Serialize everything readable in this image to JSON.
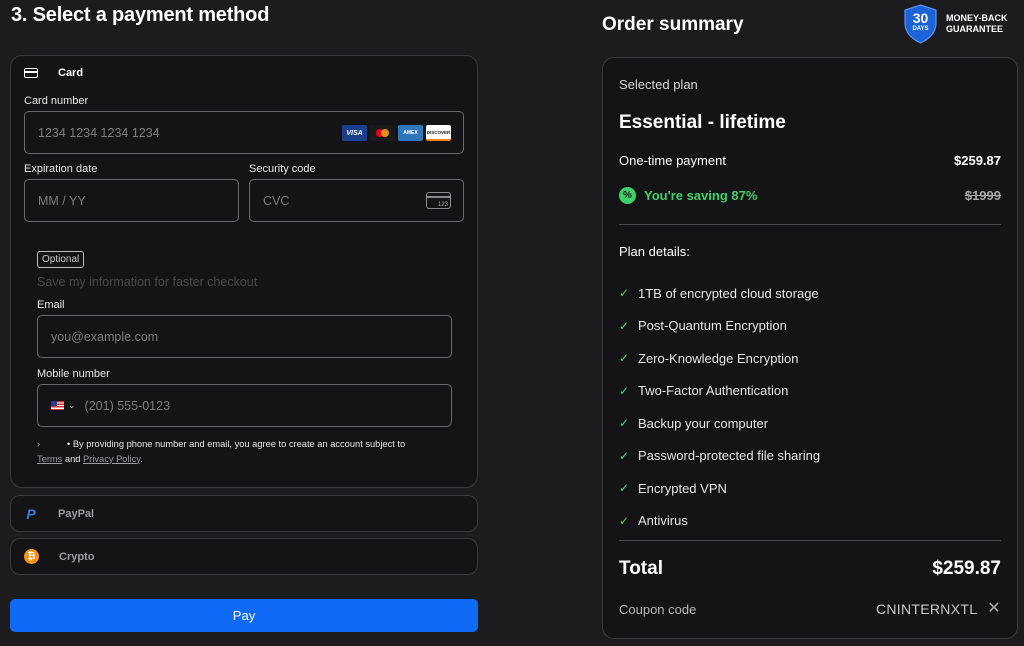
{
  "payment": {
    "title": "3. Select a payment method",
    "card": {
      "label": "Card",
      "card_number_label": "Card number",
      "card_number_placeholder": "1234 1234 1234 1234",
      "brands": [
        "VISA",
        "mastercard",
        "AMEX",
        "DISCOVER"
      ],
      "expiration_label": "Expiration date",
      "expiration_placeholder": "MM / YY",
      "security_label": "Security code",
      "security_placeholder": "CVC",
      "cvc_icon_text": "123",
      "optional_badge": "Optional",
      "save_info_text": "Save my information for faster checkout",
      "email_label": "Email",
      "email_placeholder": "you@example.com",
      "mobile_label": "Mobile number",
      "mobile_placeholder": "(201) 555-0123",
      "country_flag": "us-flag-icon",
      "consent_text": "• By providing phone number and email, you agree to create an account subject to",
      "terms_link": "Terms",
      "and_text": "and",
      "privacy_link": "Privacy Policy",
      "period": "."
    },
    "paypal_label": "PayPal",
    "crypto_label": "Crypto",
    "pay_button": "Pay"
  },
  "summary": {
    "title": "Order summary",
    "badge_number": "30",
    "badge_days": "DAYS",
    "badge_line1": "MONEY-BACK",
    "badge_line2": "GUARANTEE",
    "selected_plan_label": "Selected plan",
    "plan_name": "Essential - lifetime",
    "payment_type": "One-time payment",
    "price": "$259.87",
    "saving_text": "You're saving 87%",
    "original_price": "$1999",
    "details_title": "Plan details:",
    "features": [
      "1TB of encrypted cloud storage",
      "Post-Quantum Encryption",
      "Zero-Knowledge Encryption",
      "Two-Factor Authentication",
      "Backup your computer",
      "Password-protected file sharing",
      "Encrypted VPN",
      "Antivirus"
    ],
    "total_label": "Total",
    "total_value": "$259.87",
    "coupon_label": "Coupon code",
    "coupon_value": "CNINTERNXTL"
  },
  "colors": {
    "accent": "#0f6bf5",
    "success": "#3fd06b",
    "badge": "#1d63d8"
  }
}
